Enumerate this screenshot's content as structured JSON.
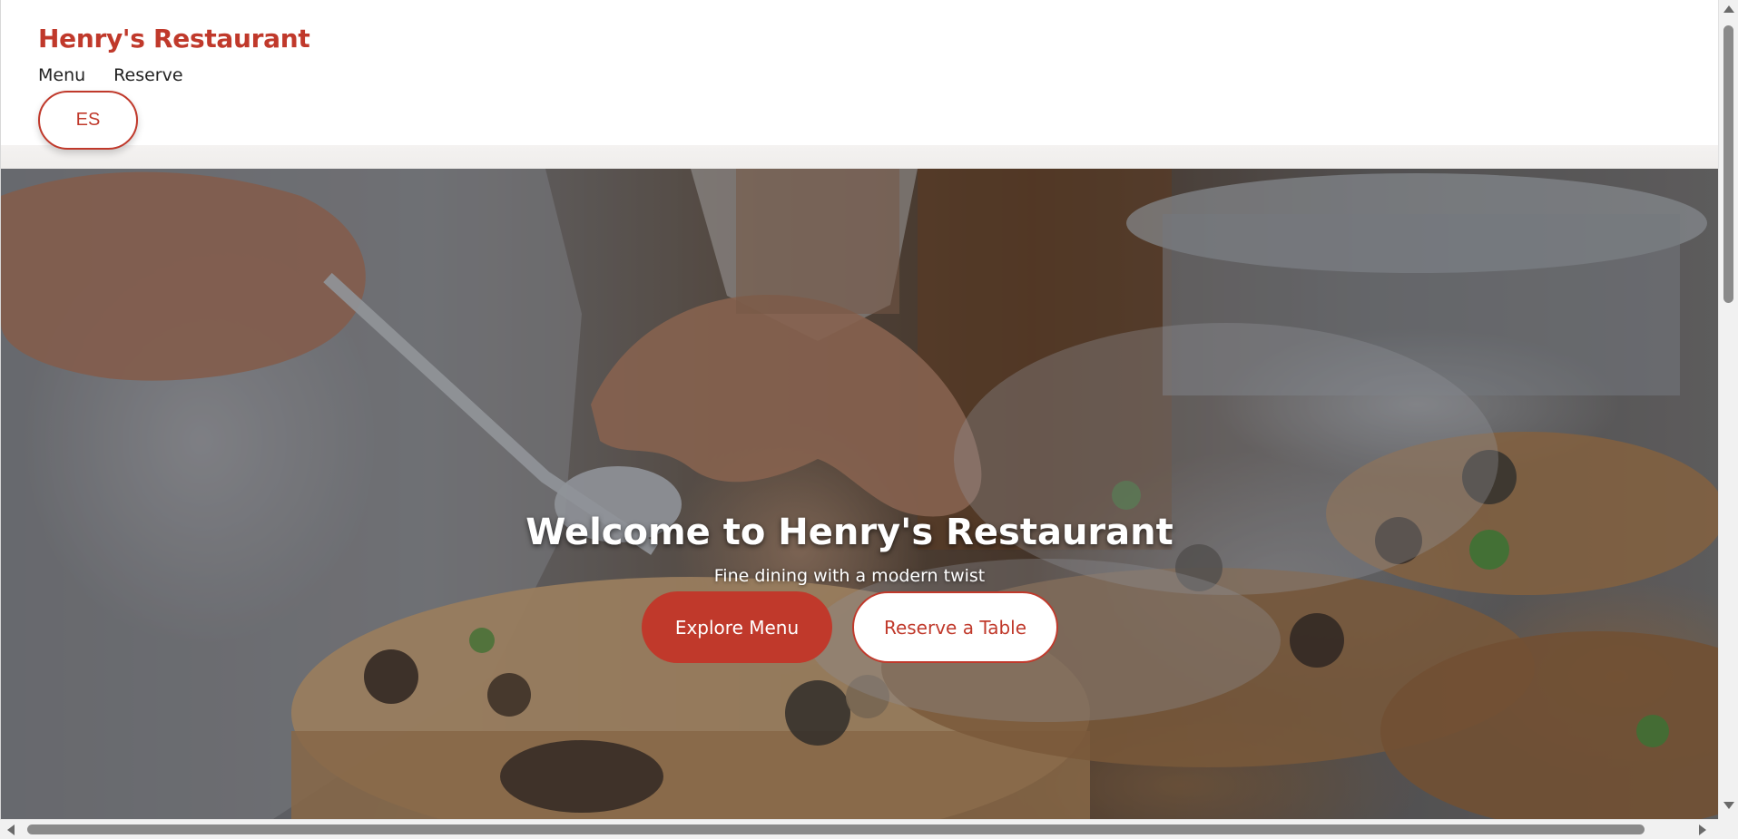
{
  "site": {
    "brand": "Henry's Restaurant",
    "accent_color": "#c0392b"
  },
  "nav": {
    "items": [
      {
        "label": "Menu"
      },
      {
        "label": "Reserve"
      }
    ],
    "language_button": "ES"
  },
  "hero": {
    "title": "Welcome to Henry's Restaurant",
    "subtitle": "Fine dining with a modern twist",
    "primary_button": "Explore Menu",
    "secondary_button": "Reserve a Table",
    "background_image": "chef plating dishes on wooden slabs with smoke"
  },
  "icons": {
    "scroll_up": "arrow-up-icon",
    "scroll_down": "arrow-down-icon",
    "scroll_left": "arrow-left-icon",
    "scroll_right": "arrow-right-icon"
  }
}
